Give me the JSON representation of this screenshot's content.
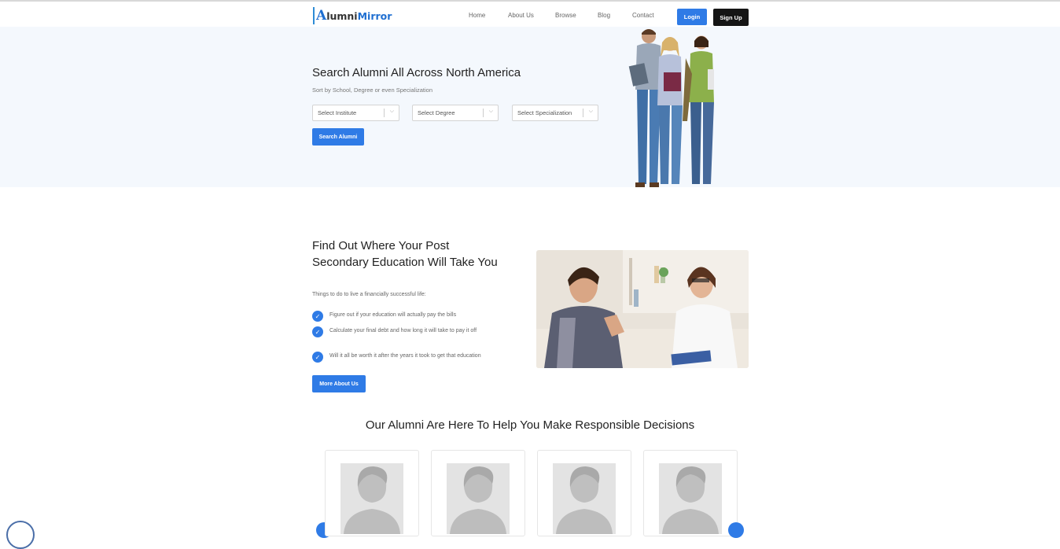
{
  "brand": {
    "logo_a": "A",
    "logo_part1": "lumni",
    "logo_part2": "Mirror"
  },
  "nav": {
    "items": [
      "Home",
      "About Us",
      "Browse",
      "Blog",
      "Contact"
    ],
    "login": "Login",
    "signup": "Sign Up"
  },
  "hero": {
    "title": "Search Alumni All Across North America",
    "subtitle": "Sort by School, Degree or even Specialization",
    "selects": [
      "Select Institute",
      "Select Degree",
      "Select Specialization"
    ],
    "search_button": "Search Alumni"
  },
  "about": {
    "title": "Find Out Where Your Post Secondary Education Will Take You",
    "subtitle": "Things to do to live a financially successful life:",
    "points": [
      "Figure out if your education will actually pay the bills",
      "Calculate your final debt and how long it will take to pay it off",
      "Will it all be worth it after the years it took to get that education"
    ],
    "button": "More About Us"
  },
  "alumni": {
    "title": "Our Alumni Are Here To Help You Make Responsible Decisions"
  },
  "colors": {
    "accent": "#2f7be6",
    "dark": "#151515",
    "hero_bg": "#f4f8fd"
  },
  "icons": {
    "check": "check-icon",
    "chevron": "chevron-down-icon",
    "avatar": "user-placeholder-icon"
  }
}
